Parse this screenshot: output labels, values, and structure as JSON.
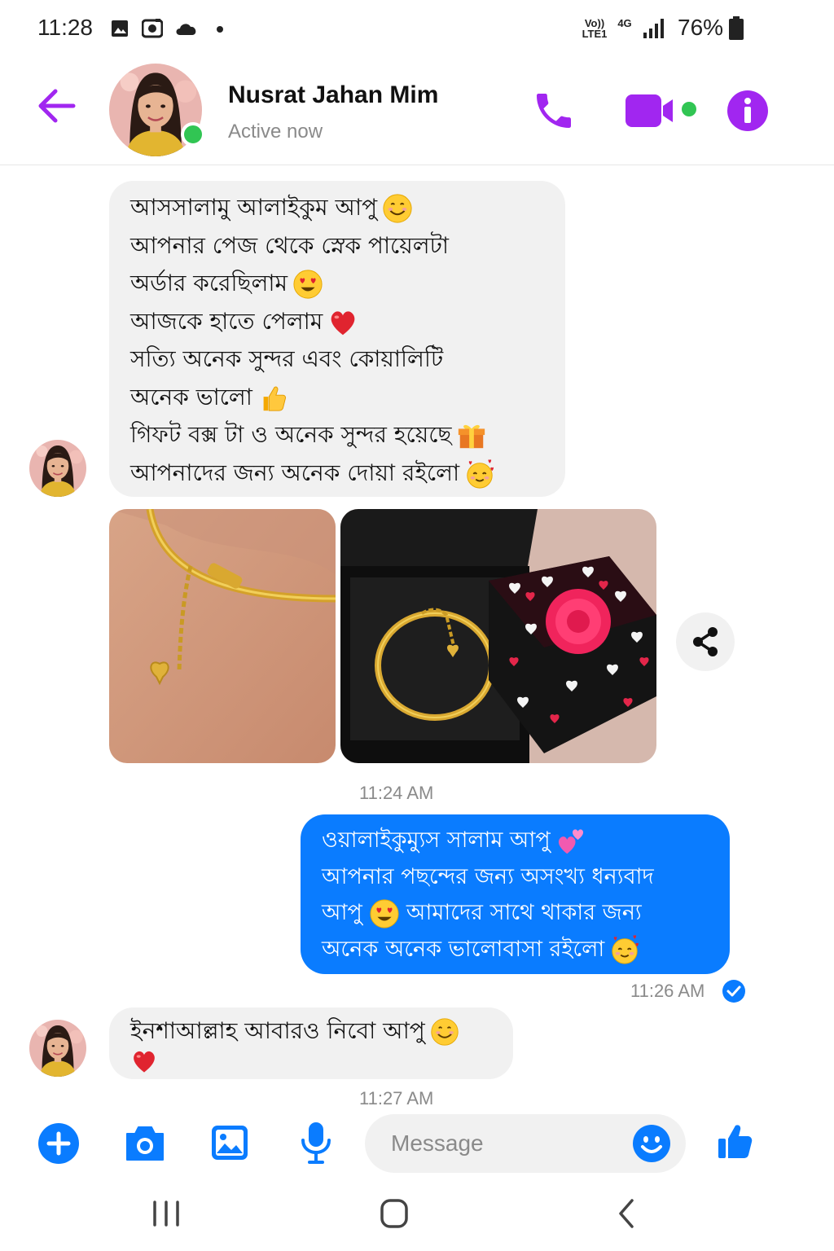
{
  "status_bar": {
    "time": "11:28",
    "battery": "76%",
    "network_volte": "Vo)) LTE1",
    "network_type": "4G"
  },
  "header": {
    "contact_name": "Nusrat Jahan Mim",
    "presence": "Active now"
  },
  "messages": {
    "incoming_1": {
      "lines": [
        "আসসালামু আলাইকুম আপু",
        "আপনার পেজ থেকে স্নেক পায়েলটা",
        "অর্ডার করেছিলাম",
        "আজকে হাতে পেলাম",
        "সত্যি অনেক সুন্দর এবং কোয়ালিটি",
        "অনেক ভালো",
        "গিফট বক্স টা ও অনেক সুন্দর হয়েছে",
        "আপনাদের জন্য অনেক দোয়া রইলো"
      ]
    },
    "time_1": "11:24 AM",
    "outgoing_1": {
      "lines": [
        "ওয়ালাইকুম্যুস সালাম আপু",
        "আপনার পছন্দের জন্য অসংখ্য ধন্যবাদ",
        "আপু",
        "আমাদের সাথে থাকার জন্য",
        "অনেক অনেক ভালোবাসা রইলো"
      ]
    },
    "time_2": "11:26 AM",
    "incoming_2": {
      "lines": [
        "ইনশাআল্লাহ আবারও নিবো আপু"
      ]
    },
    "time_3": "11:27 AM"
  },
  "composer": {
    "placeholder": "Message"
  },
  "colors": {
    "accent_purple": "#a126f0",
    "messenger_blue": "#0a7cff",
    "online_green": "#31c553",
    "incoming_bubble": "#f1f1f1"
  },
  "icons": {
    "back": "arrow-left-icon",
    "call": "phone-icon",
    "video": "video-camera-icon",
    "info": "info-icon",
    "share": "share-icon",
    "add": "plus-circle-icon",
    "camera": "camera-icon",
    "gallery": "image-icon",
    "mic": "microphone-icon",
    "emoji": "smiley-icon",
    "like": "thumbs-up-icon",
    "seen": "check-circle-icon"
  }
}
